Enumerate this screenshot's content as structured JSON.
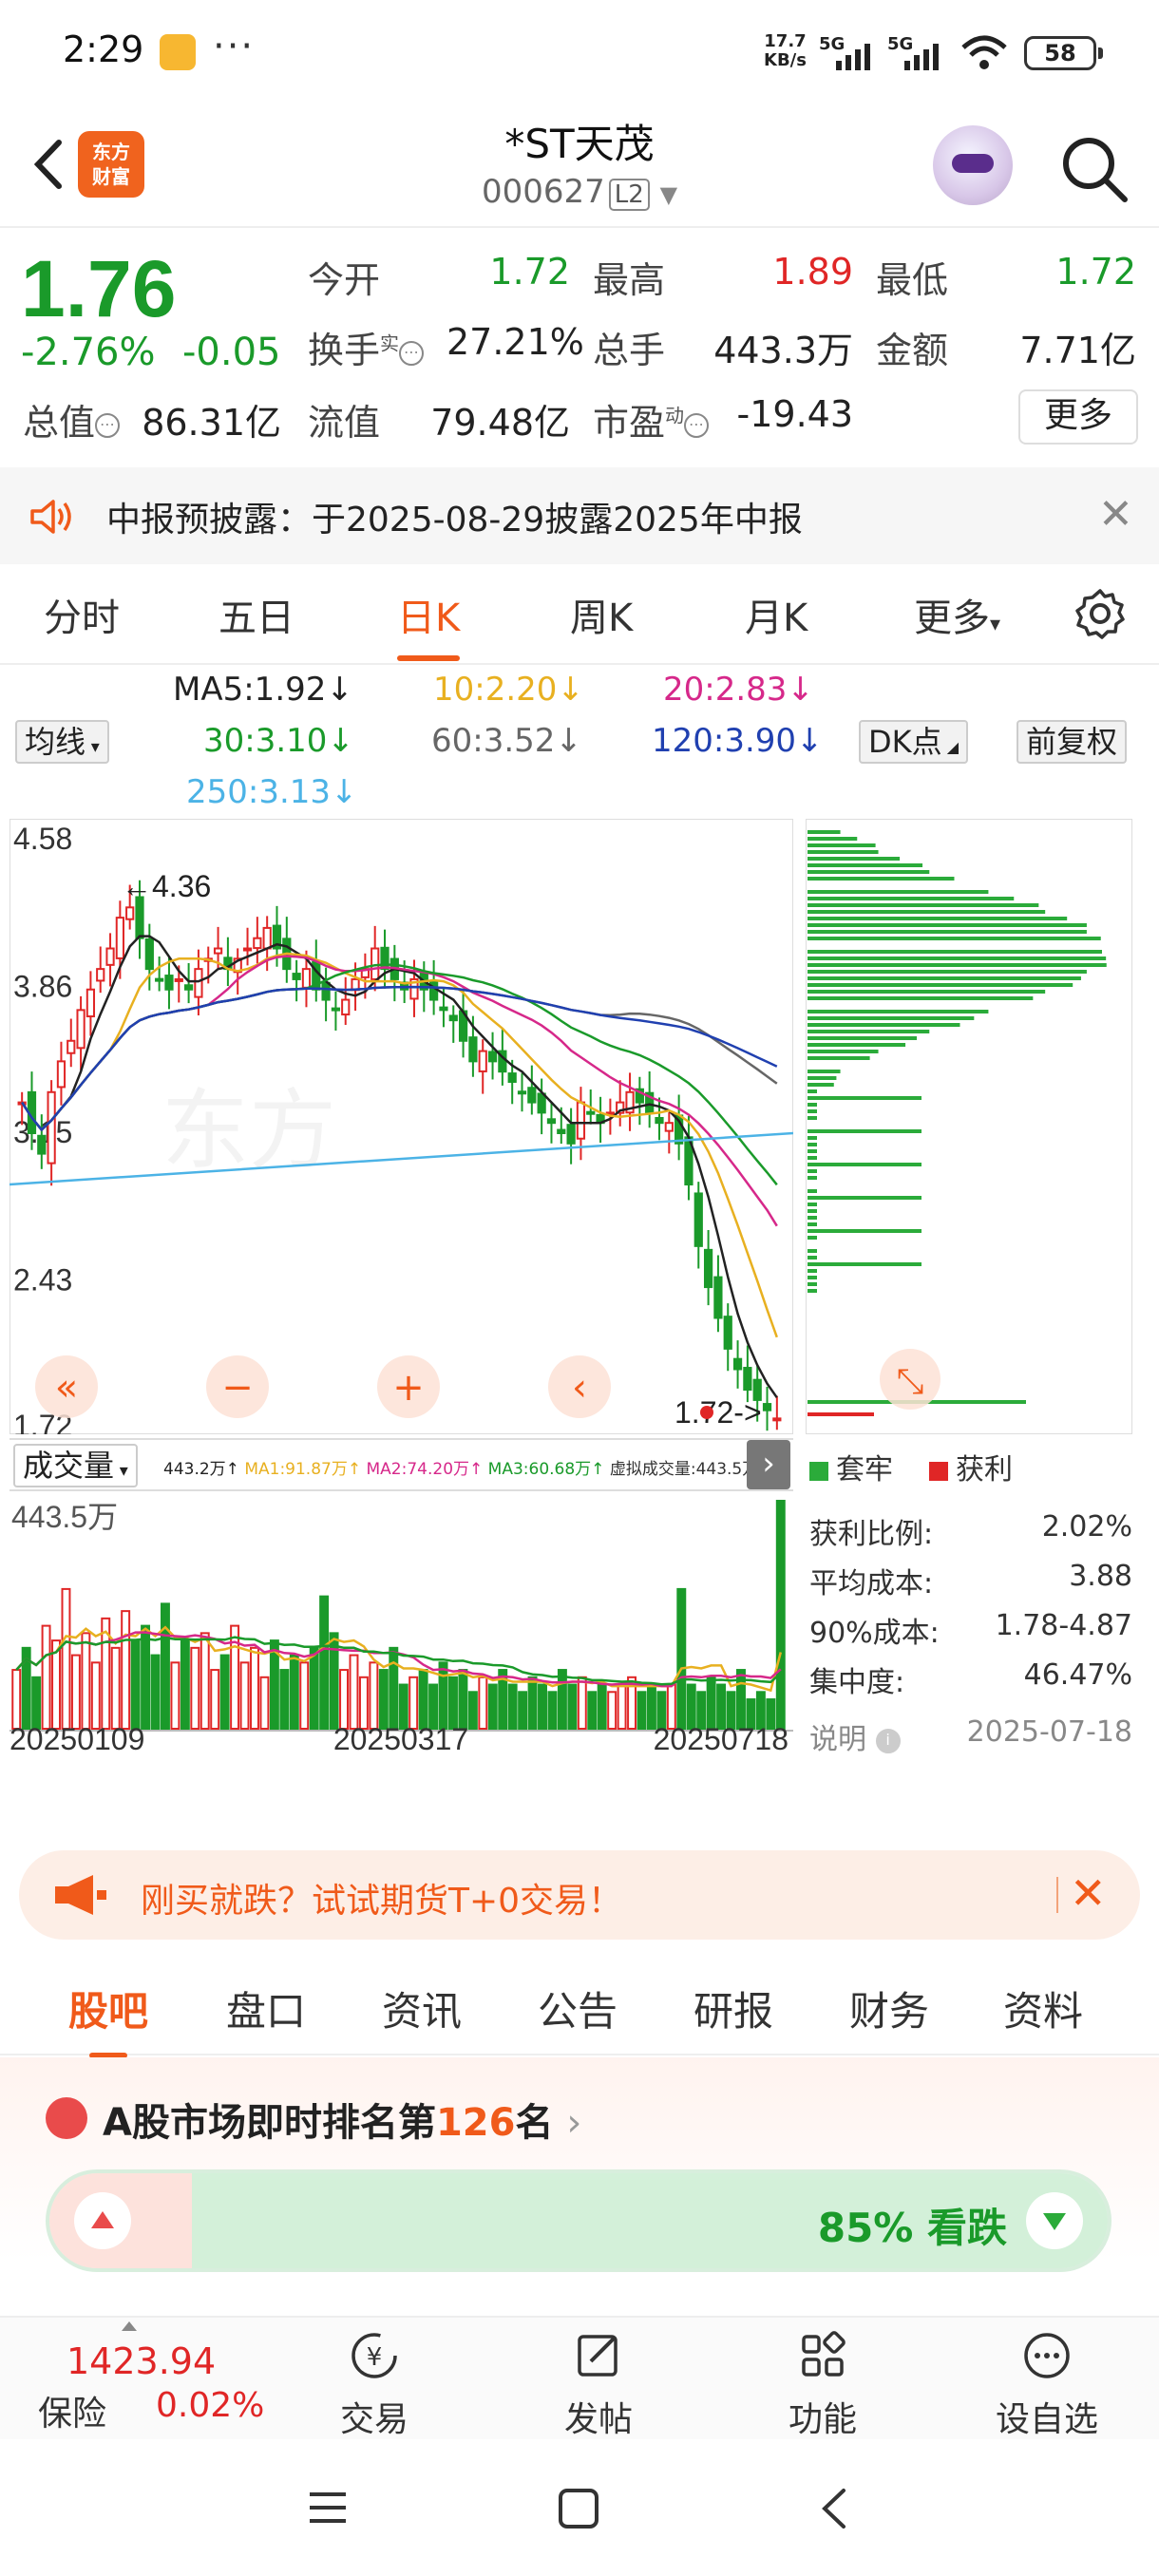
{
  "status_bar": {
    "time": "2:29",
    "net_speed_top": "17.7",
    "net_speed_unit": "KB/s",
    "sig1": "5G",
    "sig2": "5G",
    "battery": "58"
  },
  "header": {
    "logo_line1": "东方",
    "logo_line2": "财富",
    "title": "*ST天茂",
    "code": "000627",
    "level": "L2"
  },
  "quote": {
    "price": "1.76",
    "change_pct": "-2.76%",
    "change_abs": "-0.05",
    "open_label": "今开",
    "open": "1.72",
    "high_label": "最高",
    "high": "1.89",
    "low_label": "最低",
    "low": "1.72",
    "turnover_label": "换手",
    "turnover_sup": "实",
    "turnover": "27.21%",
    "volume_label": "总手",
    "volume": "443.3万",
    "amount_label": "金额",
    "amount": "7.71亿",
    "mktcap_label": "总值",
    "mktcap": "86.31亿",
    "float_label": "流值",
    "float": "79.48亿",
    "pe_label": "市盈",
    "pe_sup": "动",
    "pe": "-19.43",
    "more": "更多"
  },
  "notice": {
    "text": "中报预披露：于2025-08-29披露2025年中报"
  },
  "period_tabs": [
    "分时",
    "五日",
    "日K",
    "周K",
    "月K",
    "更多"
  ],
  "ma_legend": {
    "selector": "均线",
    "ma5": "MA5:1.92↓",
    "ma10": "10:2.20↓",
    "ma20": "20:2.83↓",
    "ma30": "30:3.10↓",
    "ma60": "60:3.52↓",
    "ma120": "120:3.90↓",
    "ma250": "250:3.13↓",
    "dk": "DK点",
    "adjust": "前复权"
  },
  "chart_data": {
    "type": "candlestick",
    "y_axis_labels": [
      "4.58",
      "3.86",
      "3.15",
      "2.43",
      "1.72"
    ],
    "ylim": [
      1.72,
      4.58
    ],
    "high_marker": "←4.36",
    "low_marker": "1.72->",
    "closes": [
      3.3,
      3.15,
      3.05,
      3.35,
      3.5,
      3.6,
      3.75,
      3.85,
      3.95,
      4.05,
      4.2,
      4.25,
      4.1,
      3.95,
      3.9,
      3.85,
      3.9,
      3.85,
      3.95,
      4.0,
      4.05,
      3.95,
      4.0,
      4.05,
      4.1,
      4.15,
      4.05,
      3.95,
      3.9,
      3.95,
      3.85,
      3.8,
      3.75,
      3.8,
      3.9,
      3.95,
      4.05,
      3.95,
      3.9,
      3.85,
      3.9,
      3.85,
      3.8,
      3.75,
      3.7,
      3.6,
      3.5,
      3.55,
      3.5,
      3.45,
      3.4,
      3.35,
      3.3,
      3.25,
      3.2,
      3.15,
      3.1,
      3.3,
      3.25,
      3.2,
      3.25,
      3.3,
      3.35,
      3.3,
      3.25,
      3.2,
      3.2,
      3.1,
      2.9,
      2.6,
      2.4,
      2.25,
      2.1,
      2.0,
      1.9,
      1.85,
      1.8,
      1.76
    ],
    "volume_label": "成交量",
    "volume_max": "443.5万",
    "volume_legend": [
      "443.2万↑",
      "MA1:91.87万↑",
      "MA2:74.20万↑",
      "MA3:60.68万↑",
      "虚拟成交量:443.5万"
    ],
    "x_labels": [
      "20250109",
      "20250317",
      "20250718"
    ],
    "volumes": [
      40,
      55,
      35,
      70,
      60,
      95,
      50,
      65,
      45,
      75,
      55,
      80,
      60,
      70,
      50,
      85,
      45,
      60,
      55,
      65,
      40,
      50,
      70,
      45,
      55,
      35,
      60,
      40,
      50,
      45,
      55,
      90,
      65,
      40,
      50,
      35,
      45,
      40,
      55,
      30,
      35,
      40,
      30,
      45,
      35,
      40,
      25,
      35,
      30,
      40,
      30,
      25,
      35,
      30,
      25,
      40,
      30,
      35,
      25,
      30,
      25,
      30,
      35,
      25,
      30,
      25,
      30,
      95,
      30,
      25,
      35,
      30,
      25,
      40,
      20,
      25,
      20,
      155
    ]
  },
  "chip": {
    "legend_hold": "套牢",
    "legend_profit": "获利",
    "stats": [
      {
        "label": "获利比例:",
        "value": "2.02%"
      },
      {
        "label": "平均成本:",
        "value": "3.88"
      },
      {
        "label": "90%成本:",
        "value": "1.78-4.87"
      },
      {
        "label": "集中度:",
        "value": "46.47%"
      }
    ],
    "note_label": "说明",
    "date": "2025-07-18"
  },
  "ad": {
    "text": "刚买就跌？试试期货T+0交易！"
  },
  "bottom_tabs": [
    "股吧",
    "盘口",
    "资讯",
    "公告",
    "研报",
    "财务",
    "资料"
  ],
  "rank": {
    "prefix": "A股市场即时排名第",
    "number": "126",
    "suffix": "名",
    "sentiment": "85% 看跌"
  },
  "bottom_nav": {
    "index_value": "1423.94",
    "index_name": "保险",
    "index_change": "0.02%",
    "items": [
      "交易",
      "发帖",
      "功能",
      "设自选"
    ]
  }
}
